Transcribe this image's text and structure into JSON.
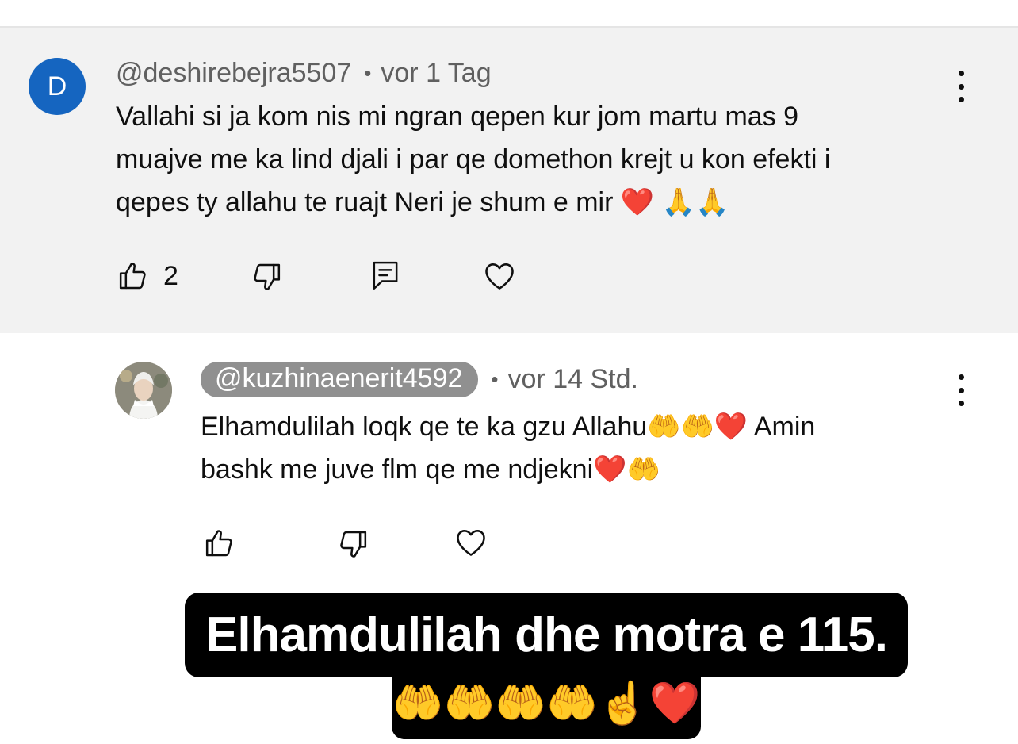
{
  "comments": [
    {
      "avatar_letter": "D",
      "author": "@deshirebejra5507",
      "separator": "•",
      "time": "vor 1 Tag",
      "text_lines": [
        "Vallahi si ja kom nis mi ngran qepen kur jom martu mas 9",
        "muajve me ka lind djali i par qe domethon krejt u kon efekti i",
        "qepes ty allahu te ruajt Neri je shum e mir ❤️ 🙏🙏"
      ],
      "like_count": "2"
    },
    {
      "author": "@kuzhinaenerit4592",
      "separator": "•",
      "time": "vor 14 Std.",
      "text_lines": [
        "Elhamdulilah loqk qe te ka gzu Allahu🤲🤲❤️  Amin",
        "bashk me juve flm qe me ndjekni❤️🤲"
      ]
    }
  ],
  "caption": {
    "line1": "Elhamdulilah dhe motra e 115.",
    "line2": "🤲🤲🤲🤲☝️❤️"
  },
  "colors": {
    "avatar_bg": "#1565c0",
    "highlight_bg": "#f2f2f2",
    "handle_pill": "#909090",
    "caption_bg": "#000000"
  }
}
